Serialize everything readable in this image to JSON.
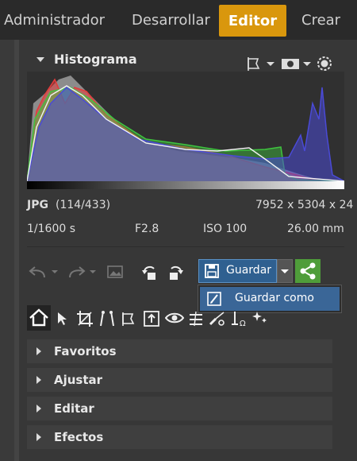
{
  "tabs": [
    {
      "label": "Administrador"
    },
    {
      "label": "Desarrollar"
    },
    {
      "label": "Editor",
      "active": true
    },
    {
      "label": "Crear"
    }
  ],
  "histogram_panel": {
    "title": "Histograma",
    "tool_icons": [
      "crop-flag-icon",
      "rectangle-mask-icon",
      "gear-icon"
    ]
  },
  "image_info": {
    "format": "JPG",
    "index": "(114/433)",
    "dimensions": "7952 x 5304 x 24",
    "shutter": "1/1600 s",
    "aperture": "F2.8",
    "iso": "ISO 100",
    "focal": "26.00 mm"
  },
  "toolbar": {
    "save_label": "Guardar",
    "save_as_label": "Guardar como",
    "icons": [
      "undo-icon",
      "redo-icon",
      "compare-icon",
      "rotate-left-icon",
      "rotate-right-icon",
      "save-icon",
      "share-icon"
    ]
  },
  "tool_strip": [
    "home-icon",
    "cursor-icon",
    "crop-icon",
    "straighten-icon",
    "perspective-icon",
    "export-icon",
    "eye-icon",
    "levels-icon",
    "brush-icon",
    "text-icon",
    "sparkle-icon"
  ],
  "sections": [
    {
      "label": "Favoritos"
    },
    {
      "label": "Ajustar"
    },
    {
      "label": "Editar"
    },
    {
      "label": "Efectos"
    }
  ],
  "colors": {
    "accent_tab": "#d9970d",
    "save_button": "#2f6090",
    "share_button": "#4f9d3a",
    "histogram_red": "#e53b3b",
    "histogram_green": "#3fc43f",
    "histogram_blue": "#4a4ad6"
  }
}
